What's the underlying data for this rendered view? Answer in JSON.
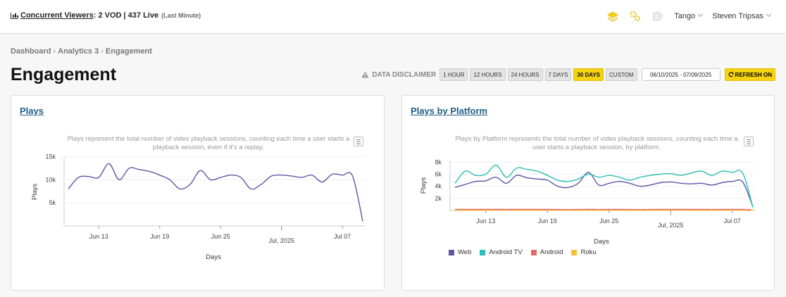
{
  "header": {
    "concurrent_label": "Concurrent Viewers",
    "concurrent_value": ": 2 VOD | 437 Live",
    "concurrent_note": "(Last Minute)",
    "org": "Tango",
    "user": "Steven Tripsas",
    "icons": [
      "layers-icon",
      "gears-icon",
      "cup-icon"
    ]
  },
  "breadcrumb": [
    "Dashboard",
    "Analytics 3",
    "Engagement"
  ],
  "page_title": "Engagement",
  "controls": {
    "disclaimer": "DATA DISCLAIMER",
    "ranges": [
      "1 HOUR",
      "12 HOURS",
      "24 HOURS",
      "7 DAYS",
      "30 DAYS",
      "CUSTOM"
    ],
    "active_range": "30 DAYS",
    "date_range": "06/10/2025 - 07/09/2025",
    "refresh": "REFRESH ON"
  },
  "colors": {
    "accent": "#f5d313",
    "link": "#1f5c85",
    "web": "#5b57a5",
    "android_tv": "#2cbfb3",
    "android": "#e8696b",
    "roku": "#f7c137"
  },
  "plays": {
    "title": "Plays",
    "description": "Plays represent the total number of video playback sessions, counting each time a user starts a playback session, even if it's a replay.",
    "chart_data": {
      "type": "line",
      "xlabel": "Days",
      "ylabel": "Plays",
      "x_ticks": [
        "Jun 13",
        "Jun 19",
        "Jun 25",
        "Jul, 2025",
        "Jul 07"
      ],
      "y_ticks": [
        "5k",
        "10k",
        "15k"
      ],
      "ylim": [
        0,
        16000
      ],
      "x": [
        "06/10",
        "06/11",
        "06/12",
        "06/13",
        "06/14",
        "06/15",
        "06/16",
        "06/17",
        "06/18",
        "06/19",
        "06/20",
        "06/21",
        "06/22",
        "06/23",
        "06/24",
        "06/25",
        "06/26",
        "06/27",
        "06/28",
        "06/29",
        "06/30",
        "07/01",
        "07/02",
        "07/03",
        "07/04",
        "07/05",
        "07/06",
        "07/07",
        "07/08",
        "07/09"
      ],
      "series": [
        {
          "values": [
            8000,
            10500,
            10700,
            10500,
            13500,
            10000,
            12500,
            12200,
            11800,
            11000,
            10000,
            8000,
            9000,
            12000,
            10000,
            10500,
            11000,
            10500,
            8000,
            9000,
            10800,
            11000,
            10800,
            10500,
            11000,
            9500,
            11200,
            11000,
            10800,
            1000
          ]
        }
      ]
    }
  },
  "platform": {
    "title": "Plays by Platform",
    "description": "Plays by Platform represents the total number of video playback sessions, counting each time a user starts a playback session, by platform.",
    "chart_data": {
      "type": "line",
      "xlabel": "Days",
      "ylabel": "Plays",
      "x_ticks": [
        "Jun 13",
        "Jun 19",
        "Jun 25",
        "Jul, 2025",
        "Jul 07"
      ],
      "y_ticks": [
        "2k",
        "4k",
        "6k",
        "8k"
      ],
      "ylim": [
        0,
        8500
      ],
      "legend_position": "bottom",
      "x": [
        "06/10",
        "06/11",
        "06/12",
        "06/13",
        "06/14",
        "06/15",
        "06/16",
        "06/17",
        "06/18",
        "06/19",
        "06/20",
        "06/21",
        "06/22",
        "06/23",
        "06/24",
        "06/25",
        "06/26",
        "06/27",
        "06/28",
        "06/29",
        "06/30",
        "07/01",
        "07/02",
        "07/03",
        "07/04",
        "07/05",
        "07/06",
        "07/07",
        "07/08",
        "07/09"
      ],
      "series": [
        {
          "name": "Web",
          "color": "#5b57a5",
          "values": [
            3800,
            4300,
            4800,
            4900,
            5500,
            4500,
            5800,
            5400,
            5200,
            5000,
            4000,
            3800,
            4500,
            6300,
            4200,
            4500,
            4800,
            4500,
            4000,
            4200,
            4600,
            4700,
            4500,
            4400,
            4500,
            4200,
            4600,
            4800,
            4700,
            600
          ]
        },
        {
          "name": "Android TV",
          "color": "#2cbfb3",
          "values": [
            4500,
            6500,
            5800,
            6000,
            7500,
            5500,
            7000,
            6800,
            6500,
            5800,
            5000,
            4800,
            5200,
            6000,
            5500,
            5800,
            5500,
            5000,
            5500,
            5800,
            6000,
            6100,
            5800,
            6200,
            6500,
            5800,
            6500,
            6300,
            6200,
            500
          ]
        },
        {
          "name": "Android",
          "color": "#e8696b",
          "values": [
            150,
            160,
            150,
            150,
            170,
            150,
            160,
            160,
            150,
            150,
            140,
            130,
            140,
            160,
            140,
            150,
            150,
            140,
            130,
            140,
            150,
            160,
            150,
            150,
            150,
            140,
            150,
            160,
            150,
            50
          ]
        },
        {
          "name": "Roku",
          "color": "#f7c137",
          "values": [
            20,
            20,
            20,
            20,
            20,
            20,
            20,
            20,
            20,
            20,
            20,
            20,
            20,
            20,
            20,
            20,
            20,
            20,
            20,
            20,
            20,
            20,
            20,
            20,
            20,
            20,
            20,
            20,
            20,
            10
          ]
        }
      ]
    }
  }
}
